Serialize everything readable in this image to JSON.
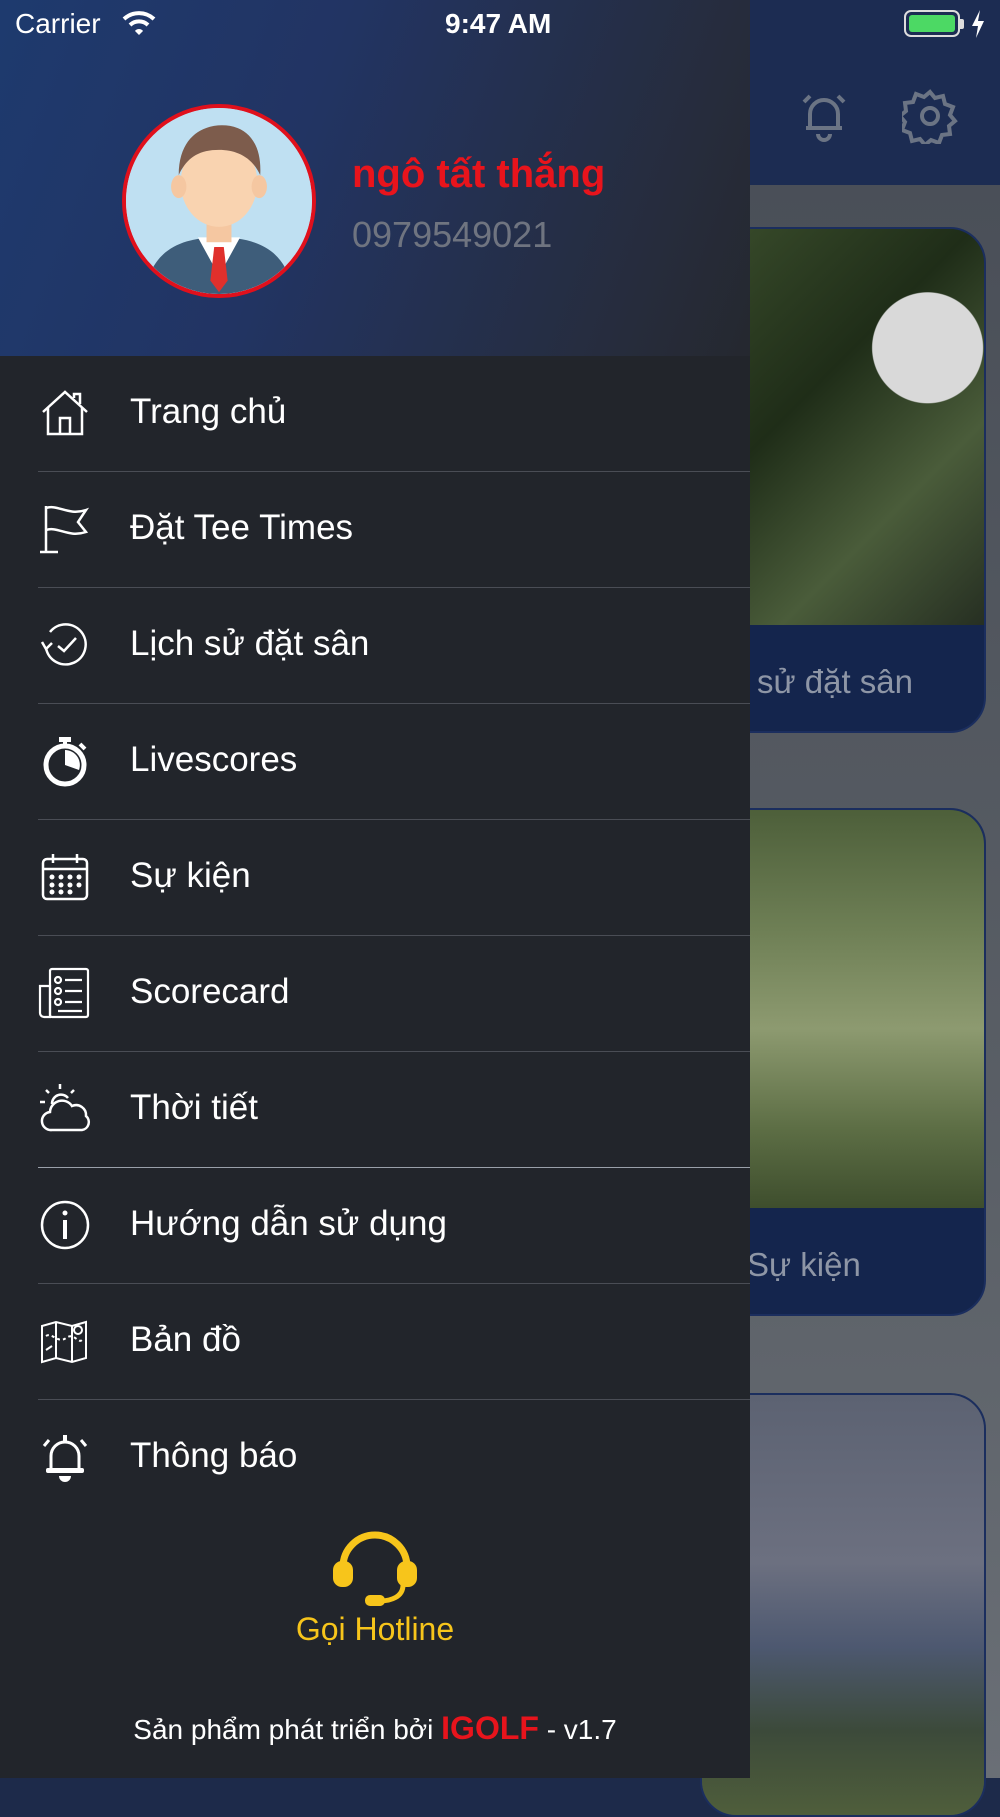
{
  "status_bar": {
    "carrier": "Carrier",
    "time": "9:47 AM"
  },
  "user": {
    "name": "ngô tất thắng",
    "phone": "0979549021"
  },
  "menu": {
    "items": [
      {
        "label": "Trang chủ",
        "icon": "home-icon"
      },
      {
        "label": "Đặt Tee Times",
        "icon": "flag-icon"
      },
      {
        "label": "Lịch sử đặt sân",
        "icon": "history-icon"
      },
      {
        "label": "Livescores",
        "icon": "stopwatch-icon"
      },
      {
        "label": "Sự kiện",
        "icon": "calendar-icon"
      },
      {
        "label": "Scorecard",
        "icon": "scorecard-icon"
      },
      {
        "label": "Thời tiết",
        "icon": "weather-icon"
      },
      {
        "label": "Hướng dẫn sử dụng",
        "icon": "info-icon"
      },
      {
        "label": "Bản đồ",
        "icon": "map-icon"
      },
      {
        "label": "Thông báo",
        "icon": "bell-icon"
      }
    ]
  },
  "hotline": {
    "label": "Gọi Hotline",
    "icon": "headset-icon"
  },
  "footer": {
    "prefix": "Sản phẩm phát triển bởi",
    "brand": "IGOLF",
    "suffix": "- v1.7"
  },
  "background": {
    "card1_caption": "sử đặt sân",
    "card2_caption": "Sự kiện"
  },
  "colors": {
    "accent": "#e8141c",
    "hotline": "#f7c51b",
    "drawer": "#22252b",
    "header": "#1e3a6e"
  }
}
